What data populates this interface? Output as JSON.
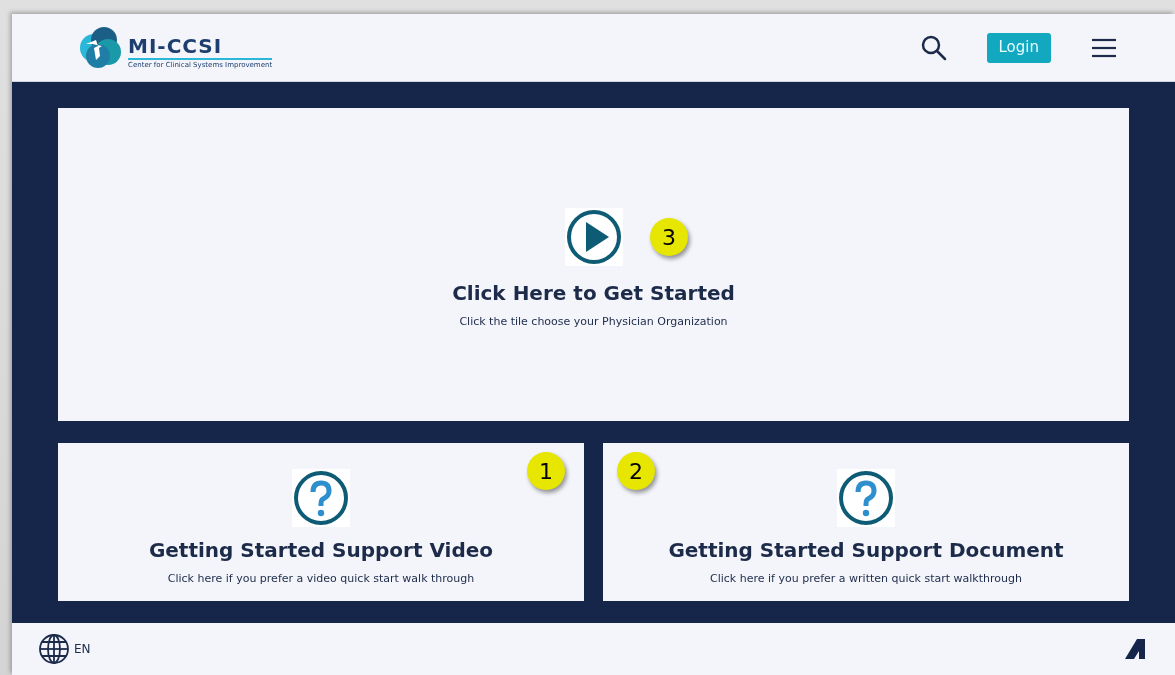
{
  "header": {
    "logo": {
      "name": "MI-CCSI",
      "tagline": "Center for Clinical Systems Improvement"
    },
    "login_button": "Login"
  },
  "tiles": [
    {
      "kind": "play",
      "title": "Click Here to Get Started",
      "subtitle": "Click the tile choose your Physician Organization",
      "callout": "3"
    },
    {
      "kind": "help",
      "title": "Getting Started Support Video",
      "subtitle": "Click here if you prefer a video quick start walk through",
      "callout": "1"
    },
    {
      "kind": "help",
      "title": "Getting Started Support Document",
      "subtitle": "Click here if you prefer a written quick start walkthrough",
      "callout": "2"
    }
  ],
  "footer": {
    "language": "EN"
  }
}
